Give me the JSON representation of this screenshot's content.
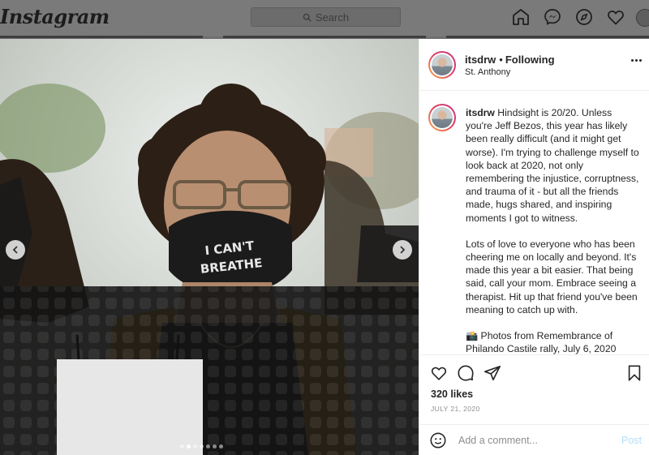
{
  "app": {
    "logo_text": "Instagram"
  },
  "topnav": {
    "search_placeholder": "Search",
    "icons": [
      "home-icon",
      "messenger-icon",
      "explore-icon",
      "heart-icon",
      "profile-avatar"
    ]
  },
  "post": {
    "author": {
      "username": "itsdrw",
      "follow_status": "Following",
      "location": "St. Anthony"
    },
    "image": {
      "description_text": "I CAN'T BREATHE",
      "carousel": {
        "count": 7,
        "active_index": 1
      }
    },
    "caption": {
      "username": "itsdrw",
      "paragraphs": [
        "Hindsight is 20/20. Unless you're Jeff Bezos, this year has likely been really difficult (and it might get worse). I'm trying to challenge myself to look back at 2020, not only remembering the injustice, corruptness, and trauma of it - but all the friends made, hugs shared, and inspiring moments I got to witness.",
        "Lots of love to everyone who has been cheering me on locally and beyond. It's made this year a bit easier. That being said, call your mom. Embrace seeing a therapist. Hit up that friend you've been meaning to catch up with.",
        "📸 Photos from Remembrance of Philando Castile rally, July 6, 2020"
      ]
    },
    "likes": "320 likes",
    "date": "JULY 21, 2020",
    "comment_box": {
      "placeholder": "Add a comment...",
      "post_label": "Post"
    }
  },
  "colors": {
    "accent": "#0095f6",
    "post_disabled": "#b2dffc",
    "text": "#262626",
    "muted": "#8e8e8e"
  }
}
